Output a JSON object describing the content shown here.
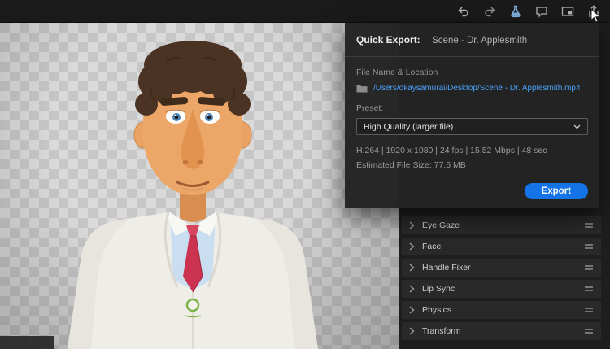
{
  "toolbar": {
    "icons": [
      {
        "name": "undo"
      },
      {
        "name": "redo"
      },
      {
        "name": "flask"
      },
      {
        "name": "comments"
      },
      {
        "name": "picture-in-picture"
      },
      {
        "name": "share-export"
      }
    ]
  },
  "quick_export": {
    "title": "Quick Export:",
    "scene_name": "Scene - Dr. Applesmith",
    "file_section_label": "File Name & Location",
    "file_path": "/Users/okaysamurai/Desktop/Scene - Dr. Applesmith.mp4",
    "preset_label": "Preset:",
    "preset_value": "High Quality (larger file)",
    "format_info": "H.264 | 1920 x 1080 | 24 fps | 15.52 Mbps | 48 sec",
    "estimated_size": "Estimated File Size: 77.6 MB",
    "export_button": "Export"
  },
  "behaviors_panel": {
    "items": [
      {
        "label": "Eye Gaze"
      },
      {
        "label": "Face"
      },
      {
        "label": "Handle Fixer"
      },
      {
        "label": "Lip Sync"
      },
      {
        "label": "Physics"
      },
      {
        "label": "Transform"
      }
    ]
  },
  "colors": {
    "accent_blue": "#1473e6",
    "link_blue": "#4a9ff5",
    "panel_dark": "#242424"
  }
}
